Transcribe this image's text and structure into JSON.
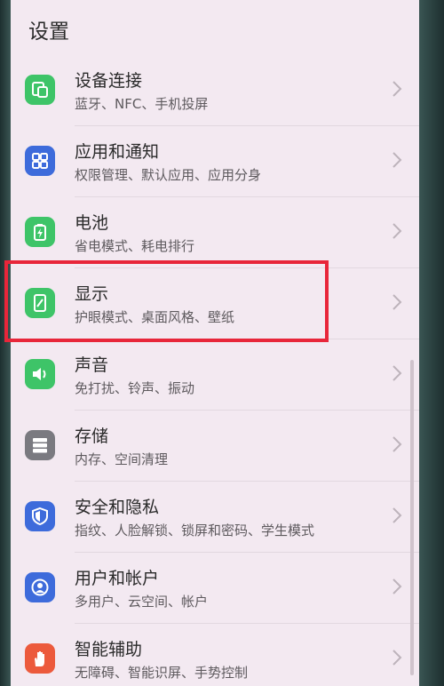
{
  "header": {
    "title": "设置"
  },
  "items": [
    {
      "label": "设备连接",
      "sub": "蓝牙、NFC、手机投屏",
      "icon": "device-connection-icon",
      "color": "#3ec468"
    },
    {
      "label": "应用和通知",
      "sub": "权限管理、默认应用、应用分身",
      "icon": "apps-icon",
      "color": "#3d6bdb"
    },
    {
      "label": "电池",
      "sub": "省电模式、耗电排行",
      "icon": "battery-icon",
      "color": "#3ec468"
    },
    {
      "label": "显示",
      "sub": "护眼模式、桌面风格、壁纸",
      "icon": "display-icon",
      "color": "#3ec468"
    },
    {
      "label": "声音",
      "sub": "免打扰、铃声、振动",
      "icon": "sound-icon",
      "color": "#3ec468"
    },
    {
      "label": "存储",
      "sub": "内存、空间清理",
      "icon": "storage-icon",
      "color": "#7a7a80"
    },
    {
      "label": "安全和隐私",
      "sub": "指纹、人脸解锁、锁屏和密码、学生模式",
      "icon": "shield-icon",
      "color": "#3d6bdb"
    },
    {
      "label": "用户和帐户",
      "sub": "多用户、云空间、帐户",
      "icon": "user-icon",
      "color": "#3d6bdb"
    },
    {
      "label": "智能辅助",
      "sub": "无障碍、智能识屏、手势控制",
      "icon": "hand-icon",
      "color": "#ec5a3c"
    }
  ]
}
